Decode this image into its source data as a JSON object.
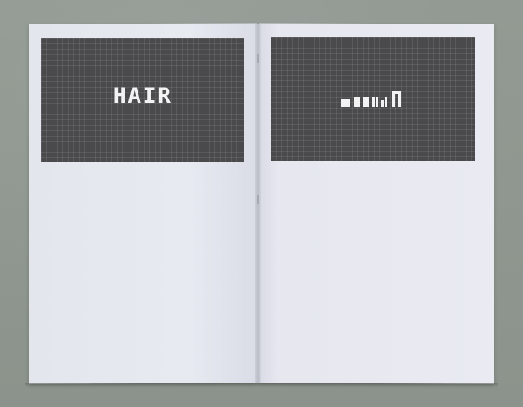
{
  "scene": {
    "description_visible_text": [
      "HAIR"
    ],
    "background_color": "#8f9790",
    "page_color": "#e8eaf2",
    "panel_color": "#4a4a4c"
  },
  "left_page": {
    "panel_text": "HAIR"
  },
  "right_page": {
    "panel_glyphs_icon": "pixel-glyphs-icon"
  }
}
